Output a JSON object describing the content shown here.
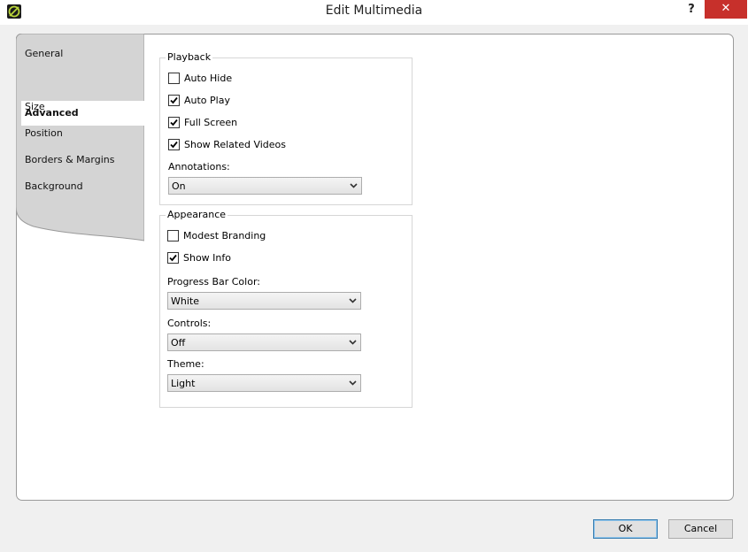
{
  "window": {
    "title": "Edit Multimedia",
    "help": "?",
    "close": "✕"
  },
  "sidebar": {
    "items": [
      {
        "label": "General"
      },
      {
        "label": "Advanced"
      },
      {
        "label": "Size"
      },
      {
        "label": "Position"
      },
      {
        "label": "Borders & Margins"
      },
      {
        "label": "Background"
      }
    ],
    "selected": "Advanced"
  },
  "playback": {
    "title": "Playback",
    "checks": [
      {
        "label": "Auto Hide",
        "checked": false
      },
      {
        "label": "Auto Play",
        "checked": true
      },
      {
        "label": "Full Screen",
        "checked": true
      },
      {
        "label": "Show Related Videos",
        "checked": true
      }
    ],
    "annotations_label": "Annotations:",
    "annotations_value": "On"
  },
  "appearance": {
    "title": "Appearance",
    "checks": [
      {
        "label": "Modest Branding",
        "checked": false
      },
      {
        "label": "Show Info",
        "checked": true
      }
    ],
    "progress_label": "Progress Bar Color:",
    "progress_value": "White",
    "controls_label": "Controls:",
    "controls_value": "Off",
    "theme_label": "Theme:",
    "theme_value": "Light"
  },
  "footer": {
    "ok": "OK",
    "cancel": "Cancel"
  },
  "colors": {
    "close_bg": "#c7302b",
    "ok_border": "#3c7fb1",
    "sidebar_bg": "#d4d4d4"
  }
}
